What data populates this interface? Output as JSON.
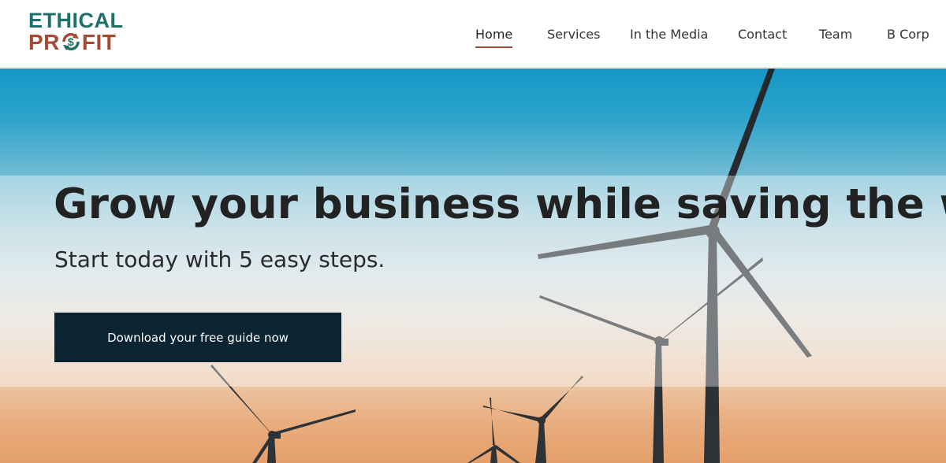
{
  "logo": {
    "line1": "ETHICAL",
    "line2_left": "PR",
    "line2_right": "FIT",
    "colors": {
      "teal": "#1f6f6a",
      "rust": "#a44a35"
    }
  },
  "nav": {
    "items": [
      {
        "label": "Home",
        "active": true
      },
      {
        "label": "Services",
        "active": false
      },
      {
        "label": "In the Media",
        "active": false
      },
      {
        "label": "Contact",
        "active": false
      },
      {
        "label": "Team",
        "active": false
      },
      {
        "label": "B Corp",
        "active": false
      }
    ]
  },
  "hero": {
    "headline": "Grow your business while saving the world.",
    "subhead": "Start today with 5 easy steps.",
    "cta_label": "Download your free guide now",
    "cta_color": "#0b2432"
  }
}
